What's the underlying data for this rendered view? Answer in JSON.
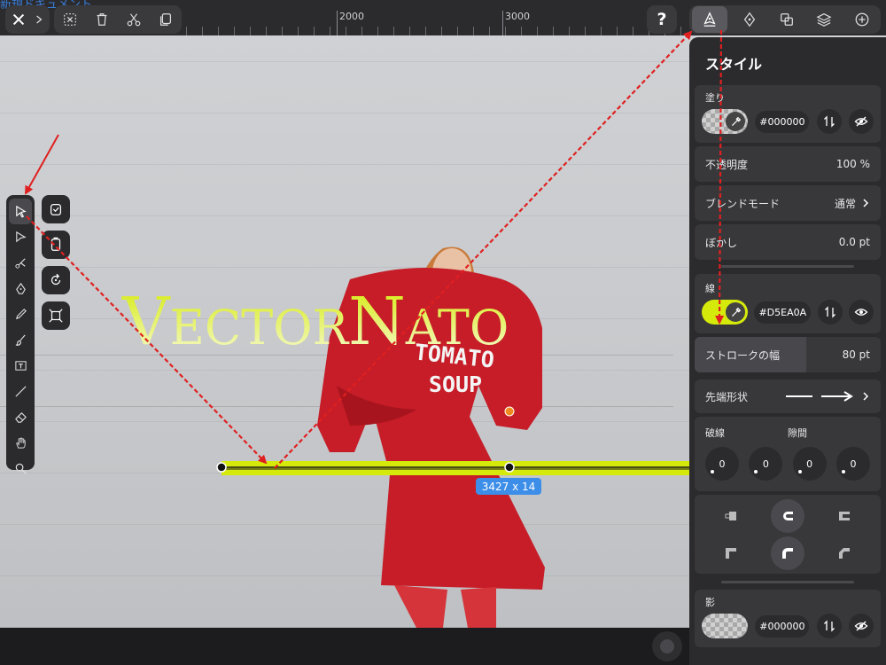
{
  "document": {
    "title": "新規ドキュメント"
  },
  "ruler": {
    "labels": [
      "2000",
      "3000"
    ]
  },
  "toolbar": {
    "help_label": "?",
    "left_icons": [
      "close-icon",
      "chevron-right-icon"
    ],
    "edit_icons": [
      "deselect-icon",
      "trash-icon",
      "scissors-icon",
      "duplicate-icon"
    ],
    "inspector_tabs": [
      "style-icon",
      "arrange-icon",
      "path-ops-icon",
      "layers-icon",
      "add-icon"
    ]
  },
  "tools": [
    "selection-tool-icon",
    "direct-select-tool-icon",
    "node-tool-icon",
    "pen-tool-icon",
    "pencil-tool-icon",
    "brush-tool-icon",
    "text-tool-icon",
    "line-tool-icon",
    "eraser-tool-icon",
    "hand-tool-icon",
    "zoom-tool-icon"
  ],
  "canvas": {
    "headline": "Vectornato",
    "shirt_line1": "TOMATO",
    "shirt_line2": "SOUP",
    "dimension_badge": "3427 x 14",
    "stroke_color": "#D5EA0A"
  },
  "panel": {
    "title": "スタイル",
    "fill": {
      "label": "塗り",
      "hex": "#000000"
    },
    "opacity": {
      "label": "不透明度",
      "value": "100 %"
    },
    "blend": {
      "label": "ブレンドモード",
      "value": "通常"
    },
    "blur": {
      "label": "ぼかし",
      "value": "0.0 pt"
    },
    "stroke": {
      "label": "線",
      "hex": "#D5EA0A"
    },
    "stroke_width": {
      "label": "ストロークの幅",
      "value": "80 pt",
      "fraction": 0.6
    },
    "endpoints": {
      "label": "先端形状"
    },
    "dash": {
      "label": "破線",
      "gap_label": "隙間",
      "values": [
        "0",
        "0",
        "0",
        "0"
      ]
    },
    "shadow": {
      "label": "影",
      "hex": "#000000"
    }
  },
  "annotations": {
    "arrow_color": "#e02020"
  }
}
